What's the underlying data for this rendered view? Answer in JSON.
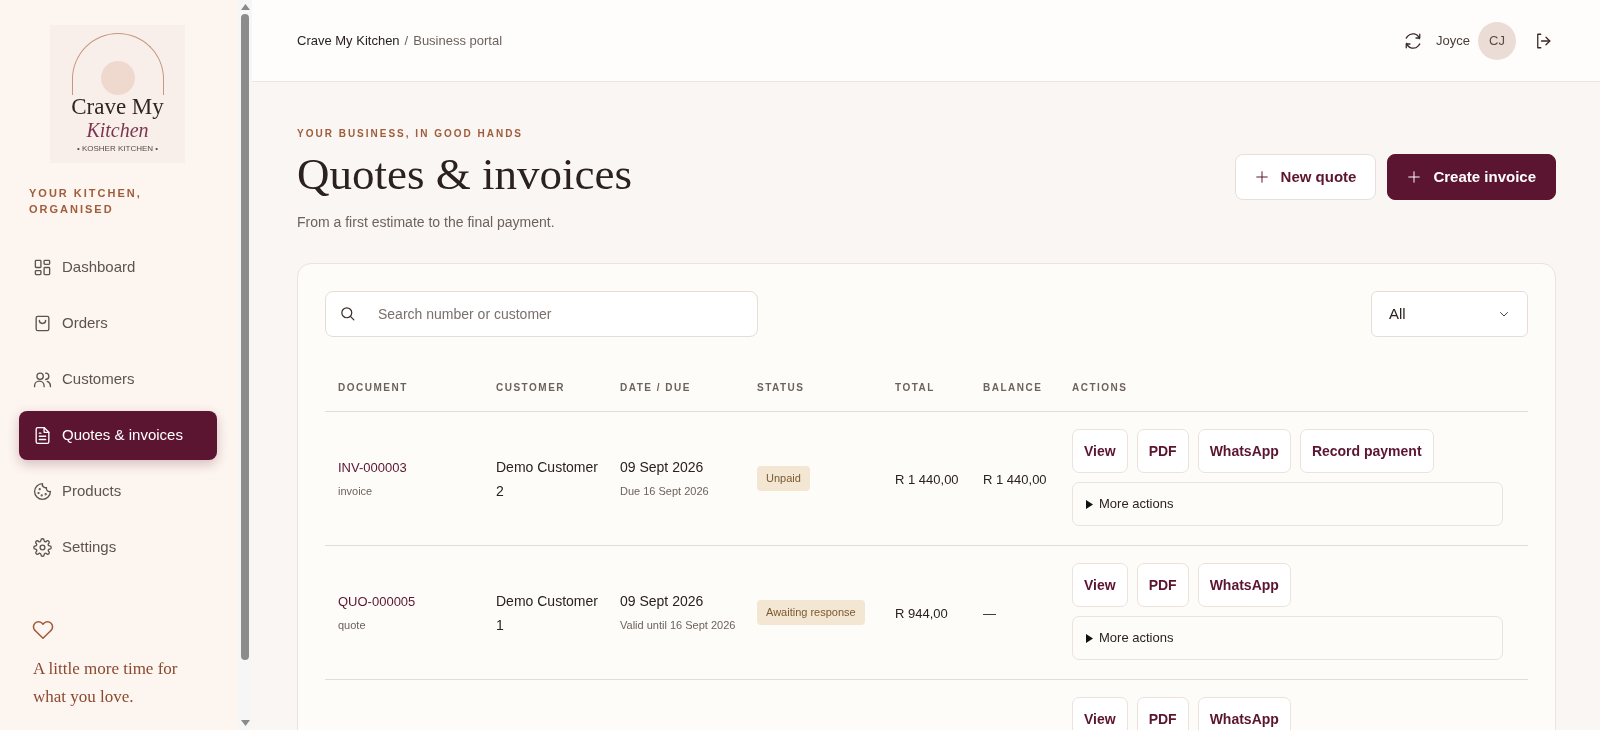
{
  "sidebar": {
    "logo": {
      "line_1": "Crave My",
      "line_2": "Kitchen",
      "tagline": "• KOSHER KITCHEN •"
    },
    "eyebrow": "YOUR KITCHEN, ORGANISED",
    "items": [
      {
        "label": "Dashboard",
        "selected": false
      },
      {
        "label": "Orders",
        "selected": false
      },
      {
        "label": "Customers",
        "selected": false
      },
      {
        "label": "Quotes & invoices",
        "selected": true
      },
      {
        "label": "Products",
        "selected": false
      },
      {
        "label": "Settings",
        "selected": false
      }
    ],
    "tagline": "A little more time for what you love."
  },
  "header": {
    "breadcrumb": [
      "Crave My Kitchen",
      "Business portal"
    ],
    "separator": "/",
    "user_name": "Joyce",
    "avatar_initials": "CJ"
  },
  "page": {
    "eyebrow": "YOUR BUSINESS, IN GOOD HANDS",
    "title": "Quotes & invoices",
    "subtitle": "From a first estimate to the final payment.",
    "buttons": [
      {
        "label": "New quote",
        "kind": "secondary"
      },
      {
        "label": "Create invoice",
        "kind": "primary"
      }
    ]
  },
  "table": {
    "search_placeholder": "Search number or customer",
    "filter": "All",
    "columns": [
      "DOCUMENT",
      "CUSTOMER",
      "DATE / DUE",
      "STATUS",
      "TOTAL",
      "BALANCE",
      "ACTIONS"
    ],
    "rows": [
      {
        "document": "INV-000003",
        "doc_type": "invoice",
        "customer": "Demo Customer 2",
        "date": "09 Sept 2026",
        "date_note": "Due 16 Sept 2026",
        "status": "Unpaid",
        "total": "R 1 440,00",
        "balance": "R 1 440,00",
        "actions": [
          "View",
          "PDF",
          "WhatsApp",
          "Record payment"
        ],
        "more_actions": "More actions",
        "expanded": false
      },
      {
        "document": "QUO-000005",
        "doc_type": "quote",
        "customer": "Demo Customer 1",
        "date": "09 Sept 2026",
        "date_note": "Valid until 16 Sept 2026",
        "status": "Awaiting response",
        "total": "R 944,00",
        "balance": "—",
        "actions": [
          "View",
          "PDF",
          "WhatsApp"
        ],
        "more_actions": "More actions",
        "expanded": false
      },
      {
        "actions": [
          "View",
          "PDF",
          "WhatsApp"
        ]
      }
    ]
  }
}
